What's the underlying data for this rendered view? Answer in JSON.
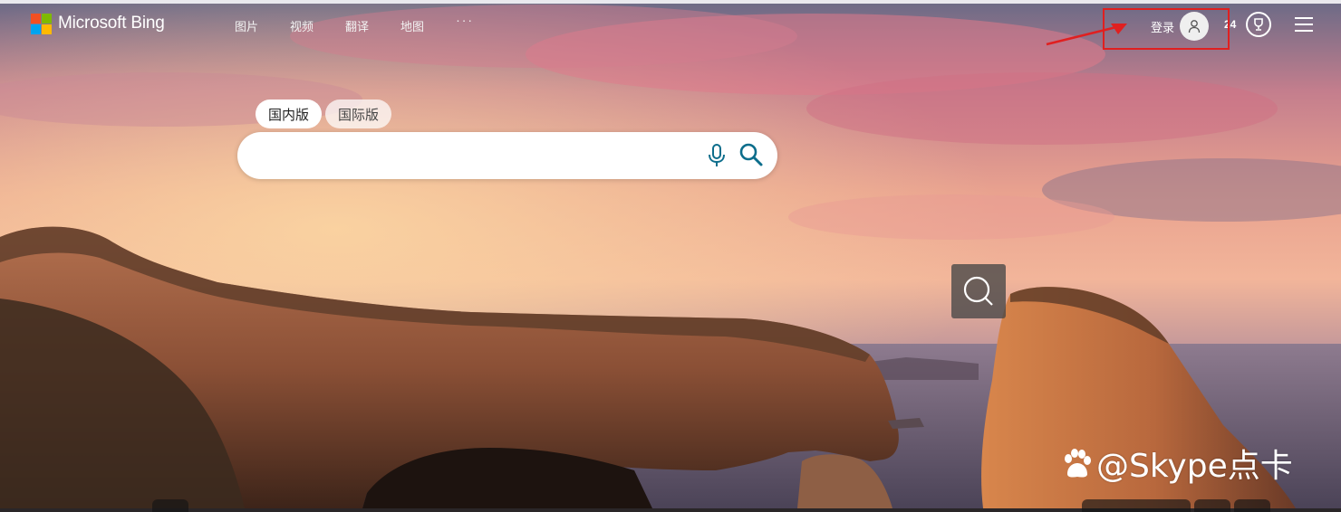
{
  "brand": {
    "name": "Microsoft Bing",
    "logo_colors": [
      "#f25022",
      "#7fba00",
      "#00a4ef",
      "#ffb900"
    ]
  },
  "nav": {
    "items": [
      "图片",
      "视频",
      "翻译",
      "地图"
    ],
    "more": "···"
  },
  "account": {
    "signin_label": "登录",
    "points": "24"
  },
  "search": {
    "tabs": [
      {
        "label": "国内版",
        "active": true
      },
      {
        "label": "国际版",
        "active": false
      }
    ],
    "placeholder": "",
    "value": "",
    "icons": {
      "voice": "mic-icon",
      "submit": "search-icon"
    }
  },
  "overlay": {
    "visual_search_icon": "visual-search-icon",
    "annotation_color": "#e02020"
  },
  "watermark": {
    "text": "@Skype点卡"
  },
  "colors": {
    "accent": "#0d6e8c",
    "highlight": "#e02020"
  }
}
